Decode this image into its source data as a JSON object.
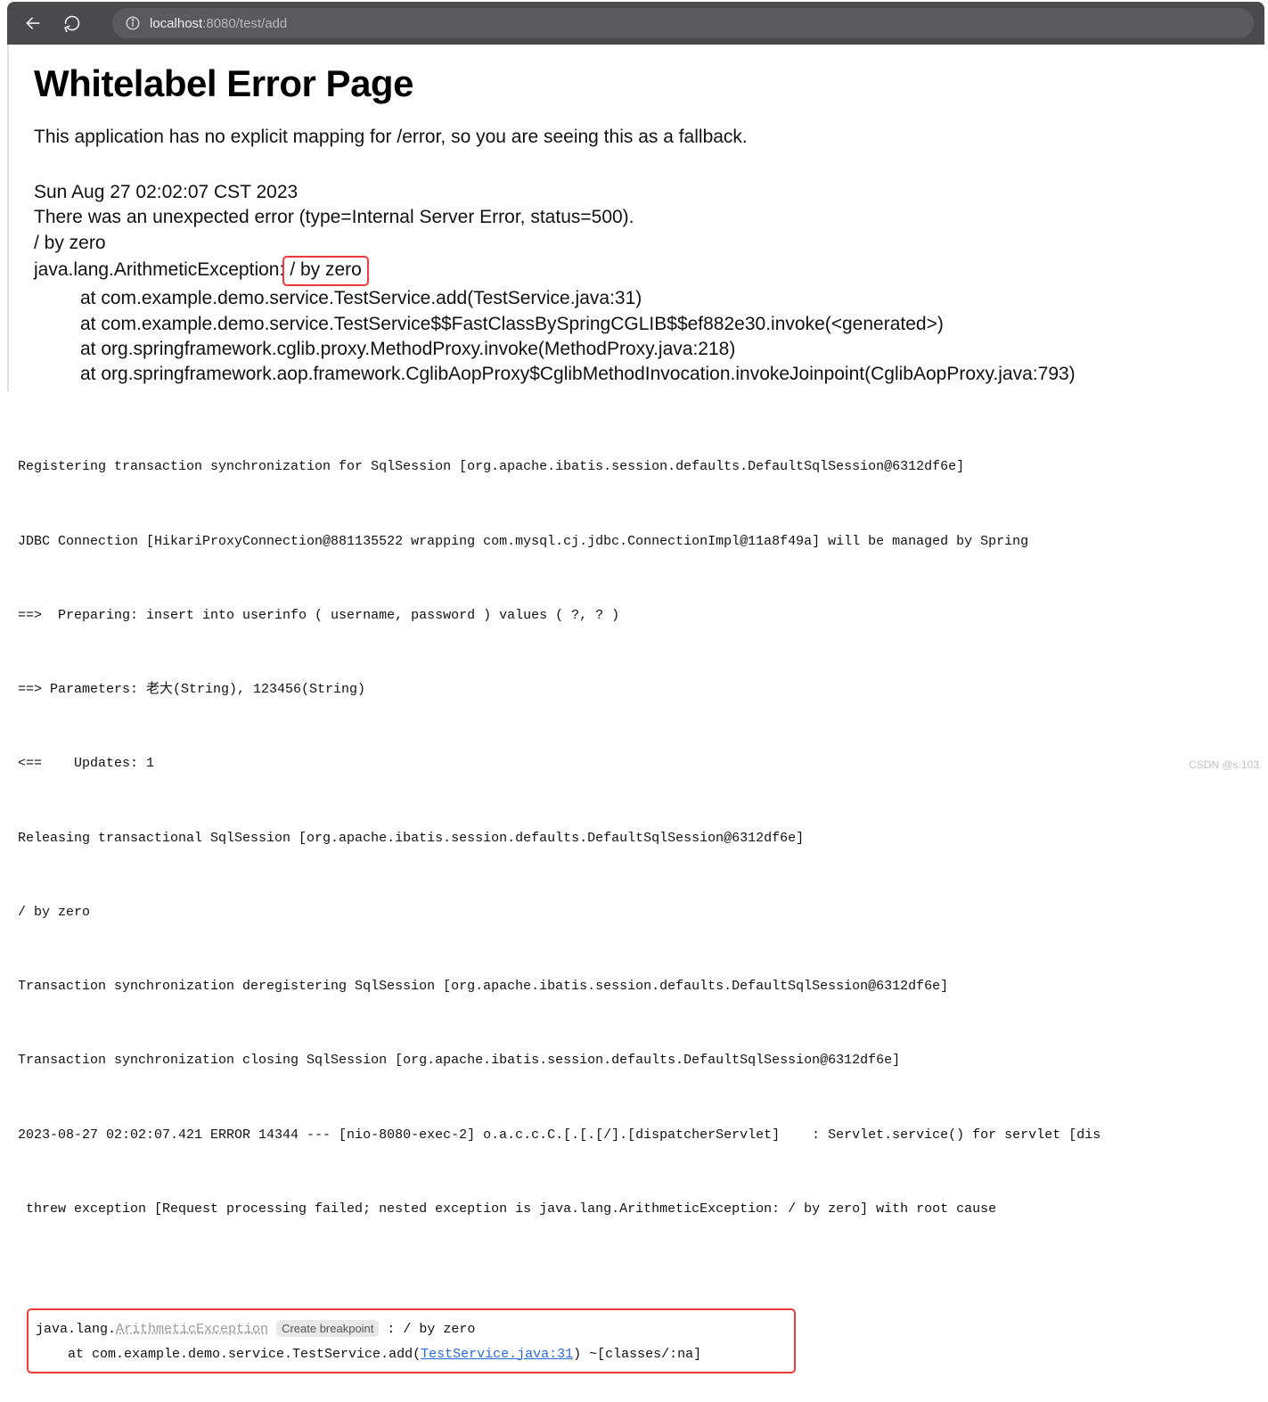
{
  "browser": {
    "url_host": "localhost",
    "url_rest": ":8080/test/add"
  },
  "error": {
    "title": "Whitelabel Error Page",
    "fallback": "This application has no explicit mapping for /error, so you are seeing this as a fallback.",
    "timestamp": "Sun Aug 27 02:02:07 CST 2023",
    "summary": "There was an unexpected error (type=Internal Server Error, status=500).",
    "message": "/ by zero",
    "exception_prefix": "java.lang.ArithmeticException:",
    "exception_highlight": " / by zero",
    "stack": [
      "at com.example.demo.service.TestService.add(TestService.java:31)",
      "at com.example.demo.service.TestService$$FastClassBySpringCGLIB$$ef882e30.invoke(<generated>)",
      "at org.springframework.cglib.proxy.MethodProxy.invoke(MethodProxy.java:218)",
      "at org.springframework.aop.framework.CglibAopProxy$CglibMethodInvocation.invokeJoinpoint(CglibAopProxy.java:793)"
    ]
  },
  "log": {
    "lines": [
      "Registering transaction synchronization for SqlSession [org.apache.ibatis.session.defaults.DefaultSqlSession@6312df6e]",
      "JDBC Connection [HikariProxyConnection@881135522 wrapping com.mysql.cj.jdbc.ConnectionImpl@11a8f49a] will be managed by Spring",
      "==>  Preparing: insert into userinfo ( username, password ) values ( ?, ? )",
      "==> Parameters: 老大(String), 123456(String)",
      "<==    Updates: 1",
      "Releasing transactional SqlSession [org.apache.ibatis.session.defaults.DefaultSqlSession@6312df6e]",
      "/ by zero",
      "Transaction synchronization deregistering SqlSession [org.apache.ibatis.session.defaults.DefaultSqlSession@6312df6e]",
      "Transaction synchronization closing SqlSession [org.apache.ibatis.session.defaults.DefaultSqlSession@6312df6e]",
      "2023-08-27 02:02:07.421 ERROR 14344 --- [nio-8080-exec-2] o.a.c.c.C.[.[.[/].[dispatcherServlet]    : Servlet.service() for servlet [dis",
      " threw exception [Request processing failed; nested exception is java.lang.ArithmeticException: / by zero] with root cause"
    ],
    "ex_block": {
      "prefix": "java.lang.",
      "clazz": "ArithmeticException",
      "breakpoint": "Create breakpoint",
      "after": " : / by zero",
      "at_prefix": "    at com.example.demo.service.TestService.add(",
      "link": "TestService.java:31",
      "at_suffix": ") ~[classes/:na]"
    }
  },
  "watermark": "CSDN @s:103"
}
